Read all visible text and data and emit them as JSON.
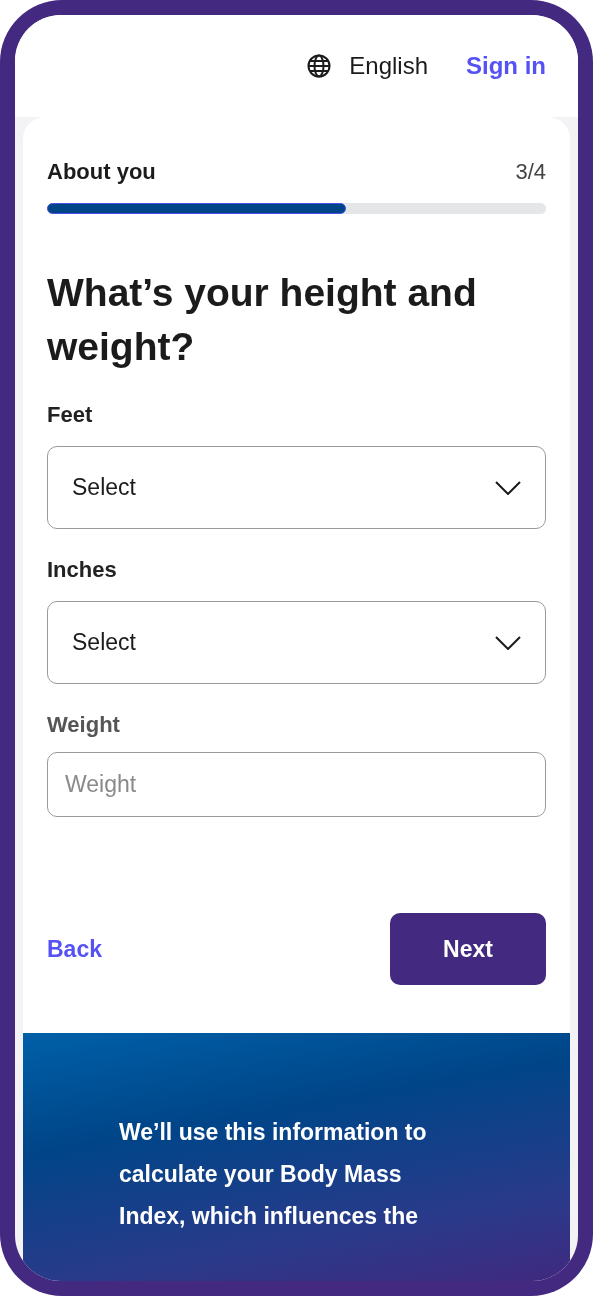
{
  "header": {
    "language": "English",
    "sign_in": "Sign in"
  },
  "progress": {
    "title": "About you",
    "step": "3/4",
    "level": 0.6
  },
  "heading": "What’s your height and weight?",
  "fields": [
    {
      "kind": "select",
      "label": "Feet",
      "value": "Select"
    },
    {
      "kind": "select",
      "label": "Inches",
      "value": "Select"
    },
    {
      "kind": "input",
      "label": "Weight",
      "placeholder": "Weight"
    }
  ],
  "actions": {
    "back": "Back",
    "next": "Next"
  },
  "info": {
    "lines": [
      "We’ll use this information to",
      "calculate your Body Mass",
      "Index, which influences the"
    ]
  }
}
